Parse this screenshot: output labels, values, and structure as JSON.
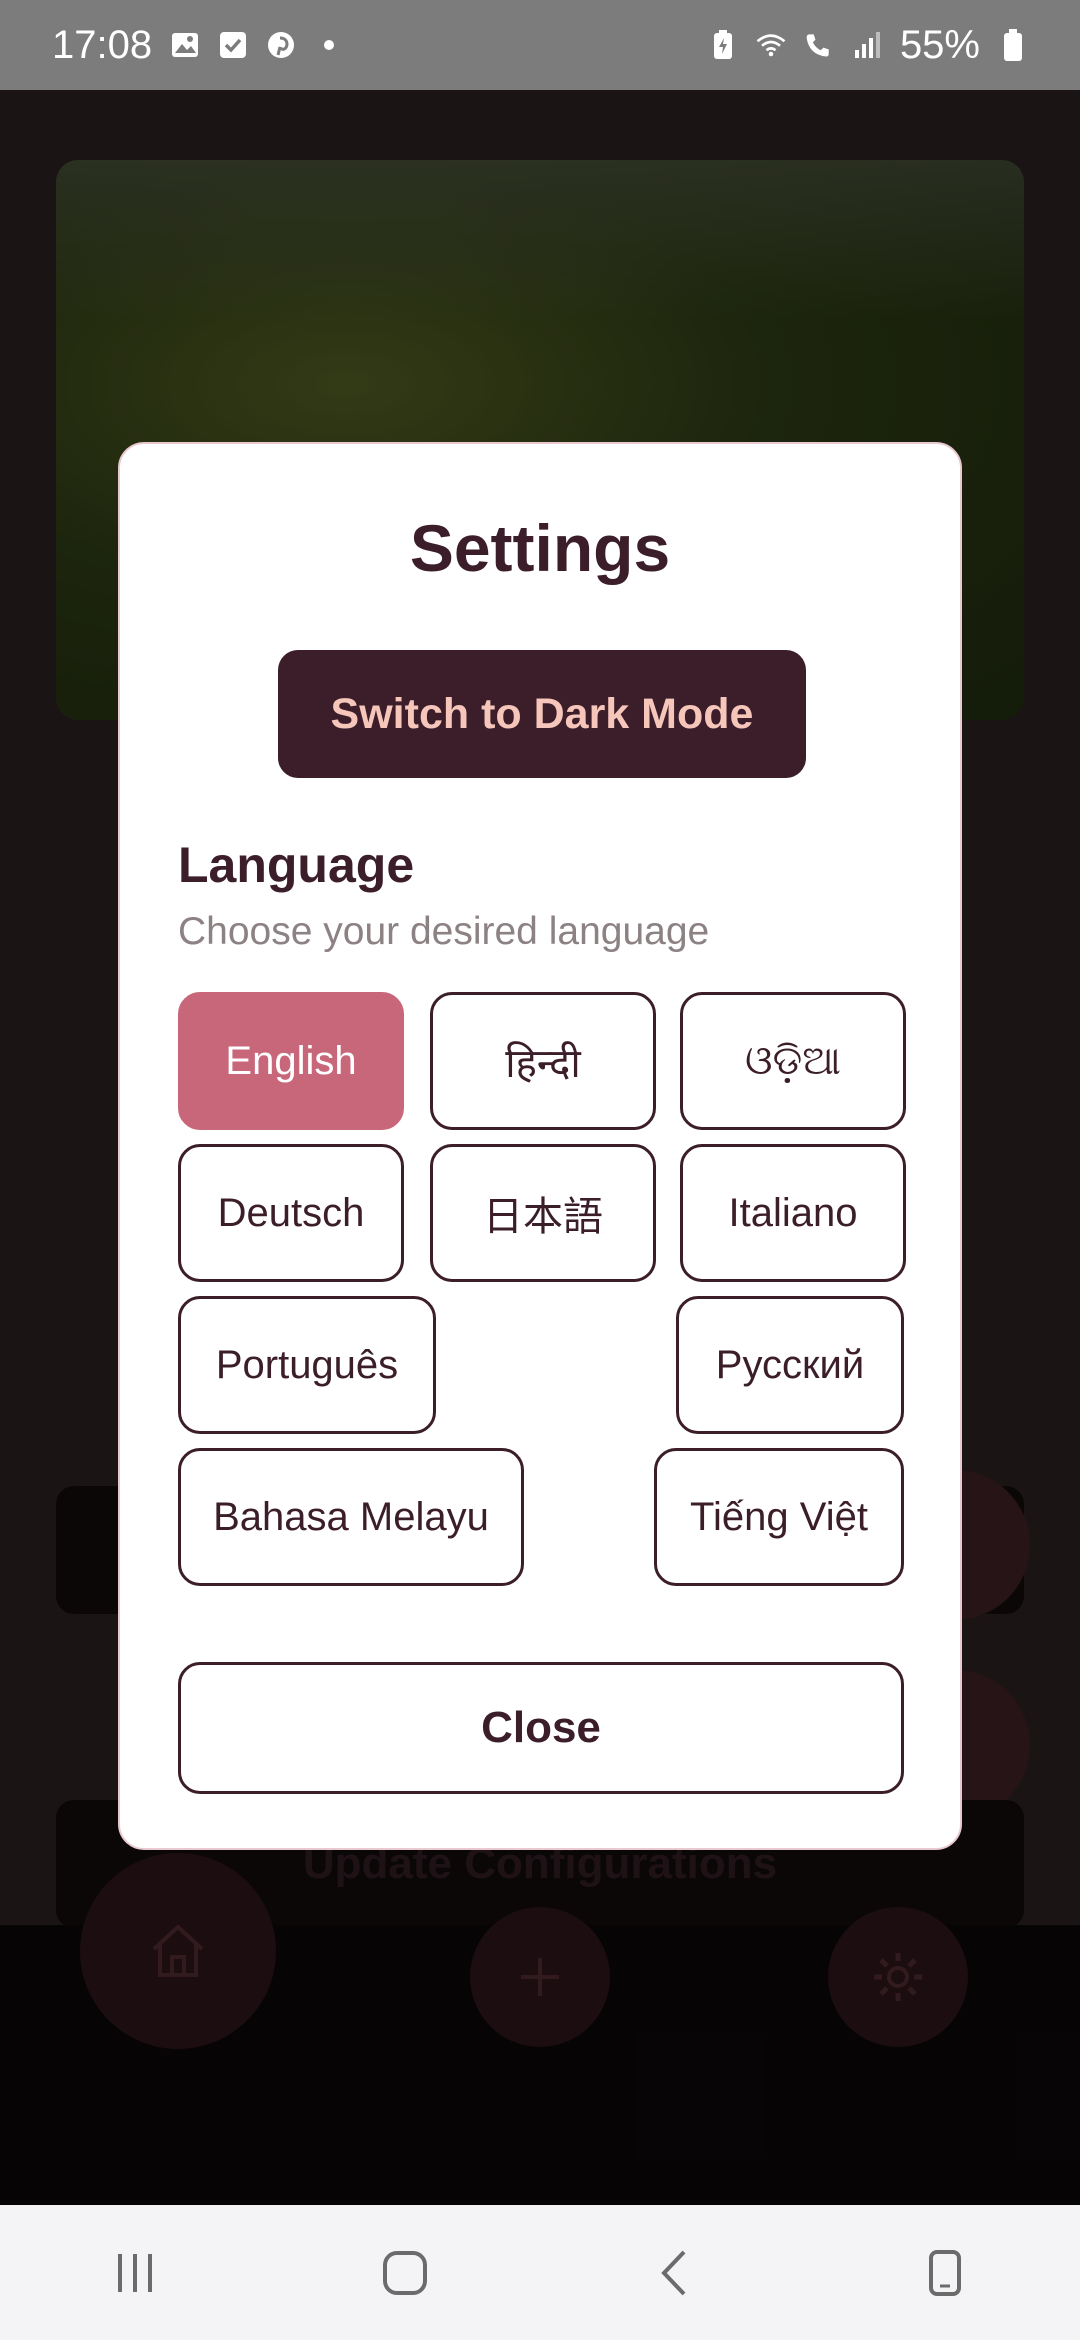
{
  "status_bar": {
    "time": "17:08",
    "battery": "55%",
    "icons_left": [
      "gallery-icon",
      "checkbox-icon",
      "pinterest-icon",
      "dot-icon"
    ],
    "icons_right": [
      "battery-saver-icon",
      "wifi-icon",
      "wifi-calling-icon",
      "signal-icon",
      "battery-icon"
    ]
  },
  "background": {
    "update_button": "Update Configurations"
  },
  "dialog": {
    "title": "Settings",
    "dark_mode_button": "Switch to Dark Mode",
    "language_title": "Language",
    "language_subtitle": "Choose your desired language",
    "languages": [
      {
        "label": "English",
        "selected": true
      },
      {
        "label": "हिन्दी",
        "selected": false
      },
      {
        "label": "ଓଡ଼ିଆ",
        "selected": false
      },
      {
        "label": "Deutsch",
        "selected": false
      },
      {
        "label": "日本語",
        "selected": false
      },
      {
        "label": "Italiano",
        "selected": false
      },
      {
        "label": "Português",
        "selected": false
      },
      {
        "label": "Русский",
        "selected": false
      },
      {
        "label": "Bahasa Melayu",
        "selected": false
      },
      {
        "label": "Tiếng Việt",
        "selected": false
      }
    ],
    "close_button": "Close"
  },
  "colors": {
    "primary": "#3b1e2a",
    "accent": "#c8667a",
    "button_text": "#f6c6bb"
  }
}
